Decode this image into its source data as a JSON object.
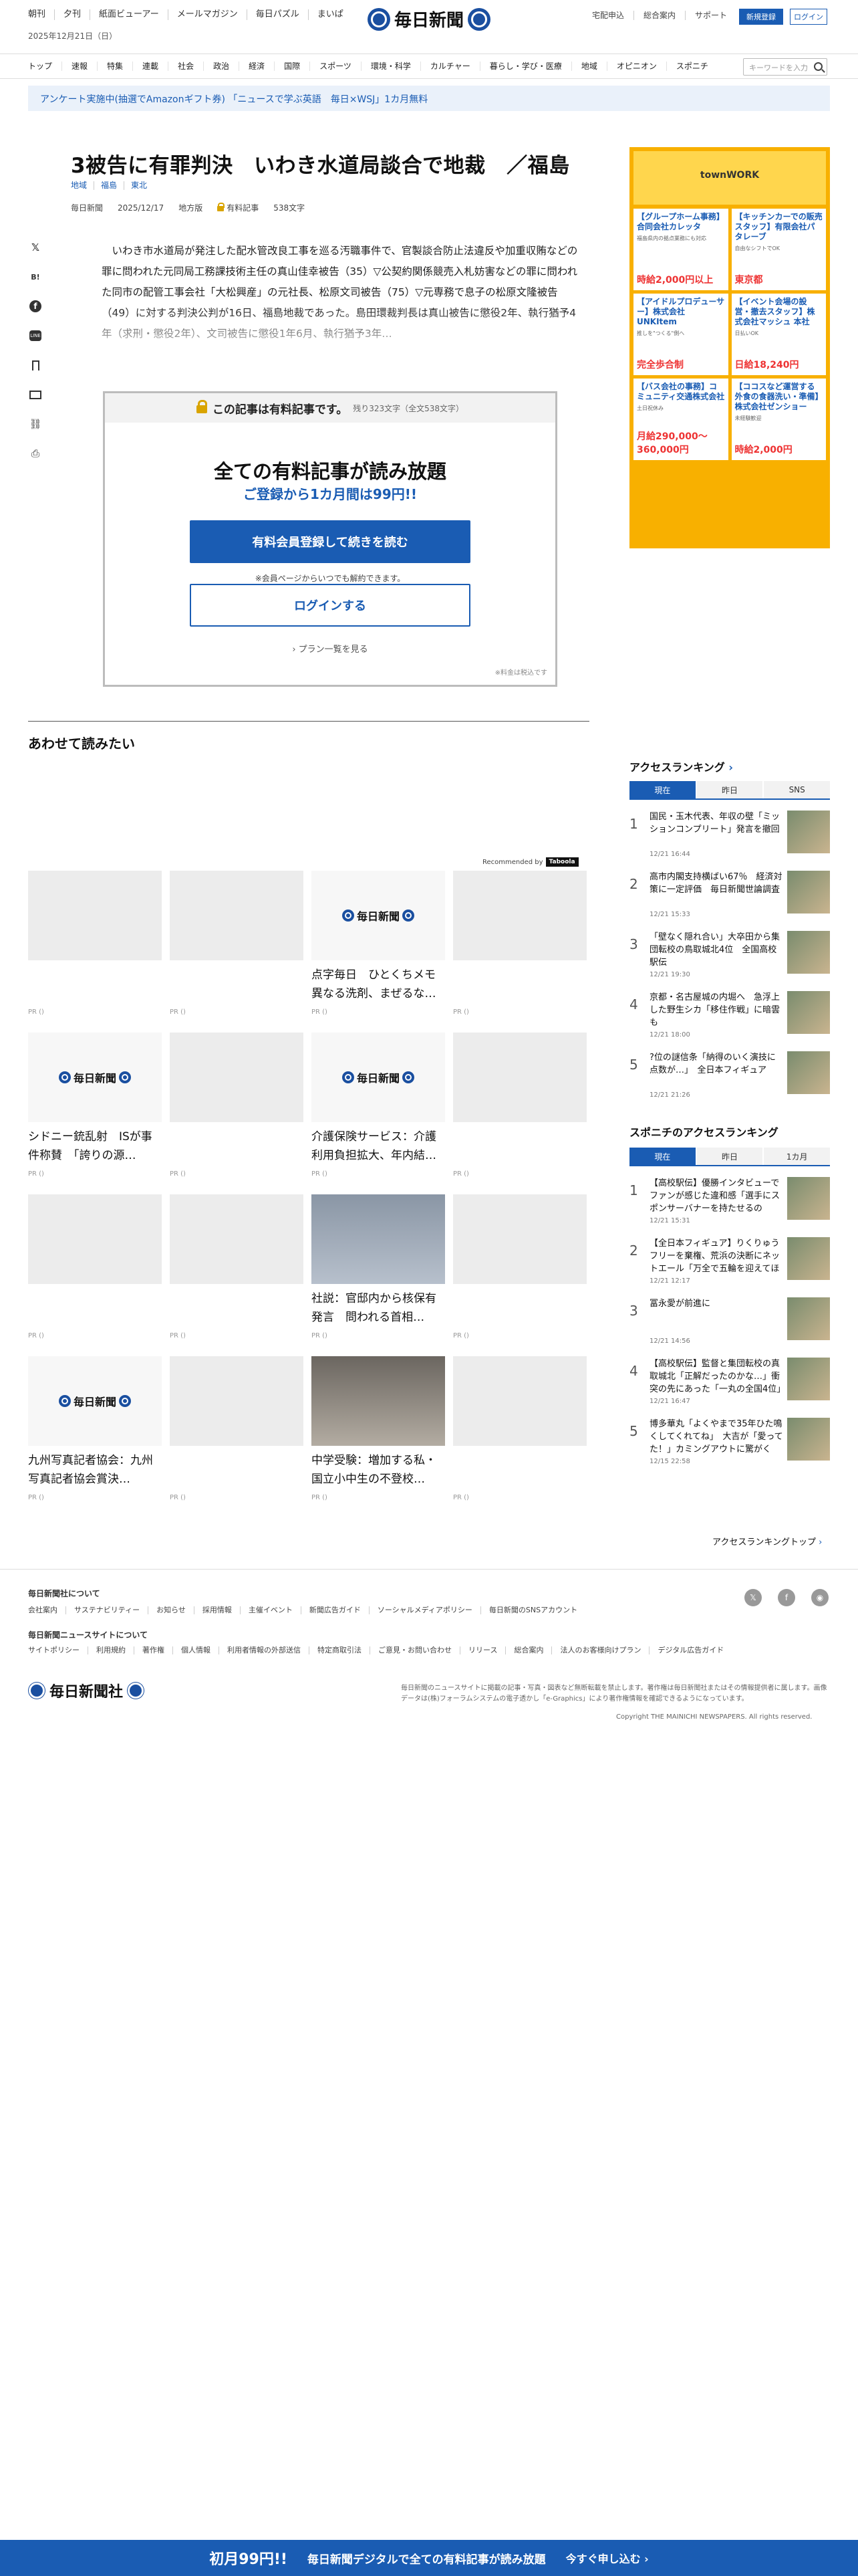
{
  "header": {
    "top_links": [
      "朝刊",
      "夕刊",
      "紙面ビューアー",
      "メールマガジン",
      "毎日パズル",
      "まいぱ"
    ],
    "date": "2025年12月21日（日）",
    "logo_text": "毎日新聞",
    "right_links": [
      "宅配申込",
      "総合案内",
      "サポート"
    ],
    "register_label": "新規登録",
    "login_label": "ログイン",
    "nav": [
      "トップ",
      "速報",
      "特集",
      "連載",
      "社会",
      "政治",
      "経済",
      "国際",
      "スポーツ",
      "環境・科学",
      "カルチャー",
      "暮らし・学び・医療",
      "地域",
      "オピニオン",
      "スポニチ"
    ],
    "search_placeholder": "キーワードを入力",
    "banner": "アンケート実施中(抽選でAmazonギフト券) 「ニュースで学ぶ英語　毎日×WSJ」1カ月無料"
  },
  "article": {
    "title": "3被告に有罪判決　いわき水道局談合で地裁　／福島",
    "categories": [
      "地域",
      "福島",
      "東北"
    ],
    "source": "毎日新聞",
    "date": "2025/12/17",
    "edition": "地方版",
    "paid_label": "有料記事",
    "chars": "538文字",
    "body": "いわき市水道局が発注した配水管改良工事を巡る汚職事件で、官製談合防止法違反や加重収賄などの罪に問われた元同局工務課技術主任の真山佳幸被告（35）▽公契約関係競売入札妨害などの罪に問われた同市の配管工事会社「大松興産」の元社長、松原文司被告（75）▽元専務で息子の松原文隆被告（49）に対する判決公判が16日、福島地裁であった。島田環裁判長は真山被告に懲役2年、執行猶予4年（求刑・懲役2年）、文司被告に懲役1年6月、執行猶予3年…"
  },
  "share": [
    "X",
    "はてな",
    "facebook",
    "LINE",
    "保存",
    "メール",
    "リンク",
    "印刷"
  ],
  "paywall": {
    "head": "この記事は有料記事です。",
    "remaining": "残り323文字（全文538文字）",
    "h1": "全ての有料記事が読み放題",
    "h2": "ご登録から1カ月間は99円!!",
    "register_button": "有料会員登録して続きを読む",
    "note": "※会員ページからいつでも解約できます。",
    "login_button": "ログインする",
    "plan_link": "プラン一覧を見る",
    "tax": "※料金は税込です"
  },
  "related": {
    "title": "あわせて読みたい",
    "recommended_by": "Recommended by",
    "rec_brand": "Taboola",
    "pr": "PR ()",
    "cards": [
      {
        "caption": ""
      },
      {
        "caption": ""
      },
      {
        "caption": "点字毎日　ひとくちメモ　異なる洗剤、まぜるな…"
      },
      {
        "caption": ""
      },
      {
        "caption": "シドニー銃乱射　ISが事件称賛　「誇りの源…"
      },
      {
        "caption": ""
      },
      {
        "caption": "介護保険サービス：介護利用負担拡大、年内結…"
      },
      {
        "caption": ""
      },
      {
        "caption": ""
      },
      {
        "caption": ""
      },
      {
        "caption": "社説：官邸内から核保有発言　問われる首相…"
      },
      {
        "caption": ""
      },
      {
        "caption": "九州写真記者協会：九州写真記者協会賞決…"
      },
      {
        "caption": ""
      },
      {
        "caption": "中学受験：増加する私・国立小中生の不登校…"
      },
      {
        "caption": ""
      }
    ]
  },
  "ad": {
    "top": "townWORK",
    "cells": [
      {
        "title": "【グループホーム事務】合同会社カレッタ",
        "sub": "福島県内の拠点業務にも対応",
        "pay": "時給2,000円以上"
      },
      {
        "title": "【キッチンカーでの販売スタッフ】有限会社パタレーブ",
        "sub": "自由なシフトでOK",
        "pay": "東京都"
      },
      {
        "title": "【アイドルプロデューサー】株式会社UNKItem",
        "sub": "推しを\"つくる\"側へ",
        "pay": "完全歩合制"
      },
      {
        "title": "【イベント会場の設営・撤去スタッフ】株式会社マッシュ 本社",
        "sub": "日払いOK",
        "pay": "日給18,240円"
      },
      {
        "title": "【バス会社の事務】コミュニティ交通株式会社",
        "sub": "土日祝休み",
        "pay": "月給290,000〜360,000円"
      },
      {
        "title": "【ココスなど運営する外食の食器洗い・準備】株式会社ゼンショー",
        "sub": "未経験歓迎",
        "pay": "時給2,000円"
      }
    ]
  },
  "ranking": {
    "title": "アクセスランキング",
    "tabs": [
      "現在",
      "昨日",
      "SNS"
    ],
    "items": [
      {
        "n": "1",
        "text": "国民・玉木代表、年収の壁「ミッションコンプリート」発言を撤回",
        "time": "12/21 16:44"
      },
      {
        "n": "2",
        "text": "高市内閣支持横ばい67％　経済対策に一定評価　毎日新聞世論調査",
        "time": "12/21 15:33"
      },
      {
        "n": "3",
        "text": "「壁なく隠れ合い」大卒田から集団転校の鳥取城北4位　全国高校駅伝",
        "time": "12/21 19:30"
      },
      {
        "n": "4",
        "text": "京都・名古屋城の内堀へ　急浮上した野生シカ「移住作戦」に暗雲も",
        "time": "12/21 18:00"
      },
      {
        "n": "5",
        "text": "?位の謎信条「納得のいく演技に点数が…」　全日本フィギュア",
        "time": "12/21 21:26"
      }
    ]
  },
  "sponichi": {
    "title": "スポニチのアクセスランキング",
    "tabs": [
      "現在",
      "昨日",
      "1カ月"
    ],
    "items": [
      {
        "n": "1",
        "text": "【高校駅伝】優勝インタビューでファンが感じた違和感「選手にスポンサーバナーを持たせるのは…」",
        "time": "12/21 15:31"
      },
      {
        "n": "2",
        "text": "【全日本フィギュア】りくりゅうフリーを棄権、荒浜の決断にネットエール「万全で五輪を迎えてほしい」",
        "time": "12/21 12:17"
      },
      {
        "n": "3",
        "text": "冨永愛が前進に",
        "time": "12/21 14:56"
      },
      {
        "n": "4",
        "text": "【高校駅伝】監督と集団転校の真取城北「正解だったのかな…」衝突の先にあった「一丸の全国4位」",
        "time": "12/21 16:47"
      },
      {
        "n": "5",
        "text": "博多華丸「よくやまで35年ひた鳴くしてくれてね」　大吉が「愛ってた！」カミングアウトに驚がく",
        "time": "12/15 22:58"
      }
    ],
    "more": "アクセスランキングトップ"
  },
  "footer": {
    "h1": "毎日新聞社について",
    "links1": [
      "会社案内",
      "サステナビリティー",
      "お知らせ",
      "採用情報",
      "主催イベント",
      "新聞広告ガイド",
      "ソーシャルメディアポリシー",
      "毎日新聞のSNSアカウント"
    ],
    "h2": "毎日新聞ニュースサイトについて",
    "links2": [
      "サイトポリシー",
      "利用規約",
      "著作権",
      "個人情報",
      "利用者情報の外部送信",
      "特定商取引法",
      "ご意見・お問い合わせ",
      "リリース",
      "総合案内",
      "法人のお客様向けプラン",
      "デジタル広告ガイド"
    ],
    "logo_text": "毎日新聞社",
    "note": "毎日新聞のニュースサイトに掲載の記事・写真・図表など無断転載を禁止します。著作権は毎日新聞社またはその情報提供者に属します。画像データは(株)フォーラムシステムの電子透かし「e-Graphics」により著作権情報を確認できるようになっています。",
    "copyright": "Copyright THE MAINICHI NEWSPAPERS. All rights reserved."
  },
  "bottom_bar": {
    "a": "初月99円!!",
    "b": "毎日新聞デジタルで全ての有料記事が読み放題",
    "c": "今すぐ申し込む ›"
  },
  "colors": {
    "brand_blue": "#1a5cb3",
    "ad_orange": "#f8b000"
  }
}
